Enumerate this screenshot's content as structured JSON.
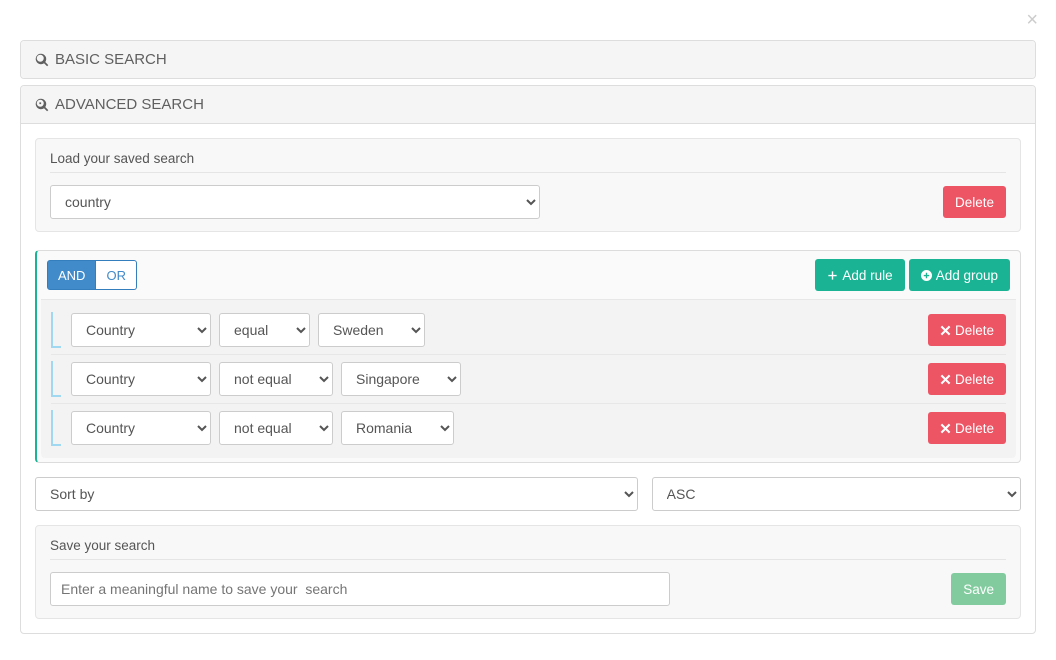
{
  "close_icon": "×",
  "basic": {
    "title": "BASIC SEARCH"
  },
  "advanced": {
    "title": "ADVANCED SEARCH",
    "load": {
      "label": "Load your saved search",
      "selected": "country",
      "delete_label": "Delete"
    },
    "builder": {
      "and_label": "AND",
      "or_label": "OR",
      "add_rule_label": "Add rule",
      "add_group_label": "Add group",
      "rules": [
        {
          "field": "Country",
          "operator": "equal",
          "value": "Sweden",
          "delete_label": "Delete"
        },
        {
          "field": "Country",
          "operator": "not equal",
          "value": "Singapore",
          "delete_label": "Delete"
        },
        {
          "field": "Country",
          "operator": "not equal",
          "value": "Romania",
          "delete_label": "Delete"
        }
      ]
    },
    "sort": {
      "sortby_label": "Sort by",
      "direction": "ASC"
    },
    "save": {
      "label": "Save your search",
      "placeholder": "Enter a meaningful name to save your  search",
      "button_label": "Save"
    }
  }
}
